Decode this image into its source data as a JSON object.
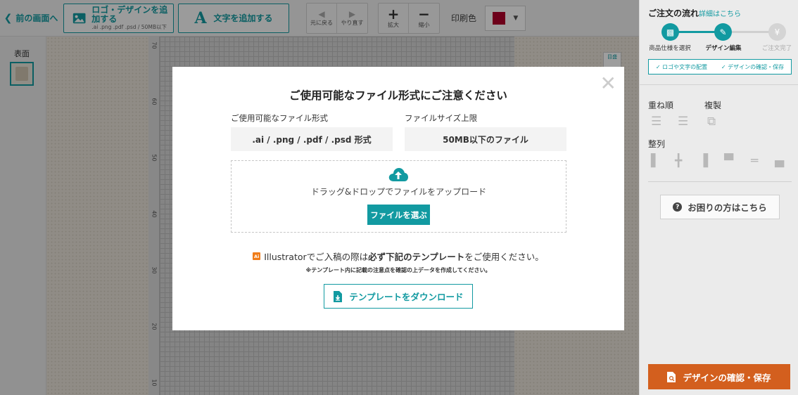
{
  "toolbar": {
    "back_label": "前の画面へ",
    "logo_btn_main": "ロゴ・デザインを追加する",
    "logo_btn_sub": ".ai .png .pdf .psd / 50MB以下",
    "text_btn_label": "文字を追加する",
    "undo_label": "元に戻る",
    "redo_label": "やり直す",
    "zoom_in_label": "拡大",
    "zoom_out_label": "縮小",
    "print_color_label": "印刷色",
    "print_color": "#b0002a"
  },
  "left": {
    "face_label": "表面"
  },
  "canvas": {
    "ruler_ticks": [
      "70",
      "60",
      "50",
      "40",
      "30",
      "20",
      "10"
    ],
    "guide_tag": "目盛"
  },
  "modal": {
    "title": "ご使用可能なファイル形式にご注意ください",
    "formats_label": "ご使用可能なファイル形式",
    "formats_value": ".ai / .png / .pdf / .psd 形式",
    "size_label": "ファイルサイズ上限",
    "size_value": "50MB以下のファイル",
    "drop_text": "ドラッグ&ドロップでファイルをアップロード",
    "choose_btn": "ファイルを選ぶ",
    "ai_badge": "Ai",
    "ai_note_1": "Illustratorでご入稿の際は",
    "ai_note_bold": "必ず下記のテンプレート",
    "ai_note_2": "をご使用ください。",
    "small_note": "※テンプレート内に記載の注意点を確認の上データを作成してください。",
    "download_btn": "テンプレートをダウンロード"
  },
  "right": {
    "flow_title": "ご注文の流れ",
    "flow_link": "詳細はこちら",
    "steps": [
      {
        "label": "商品仕様を選択"
      },
      {
        "label": "デザイン編集"
      },
      {
        "label": "ご注文完了"
      }
    ],
    "substep_1": "✓ ロゴや文字の配置",
    "substep_2": "✓ デザインの確認・保存",
    "stack_label": "重ね順",
    "copy_label": "複製",
    "align_label": "整列",
    "help_btn": "お困りの方はこちら",
    "confirm_btn": "デザインの確認・保存",
    "accent": "#129aa1",
    "confirm_color": "#d35f1e"
  }
}
